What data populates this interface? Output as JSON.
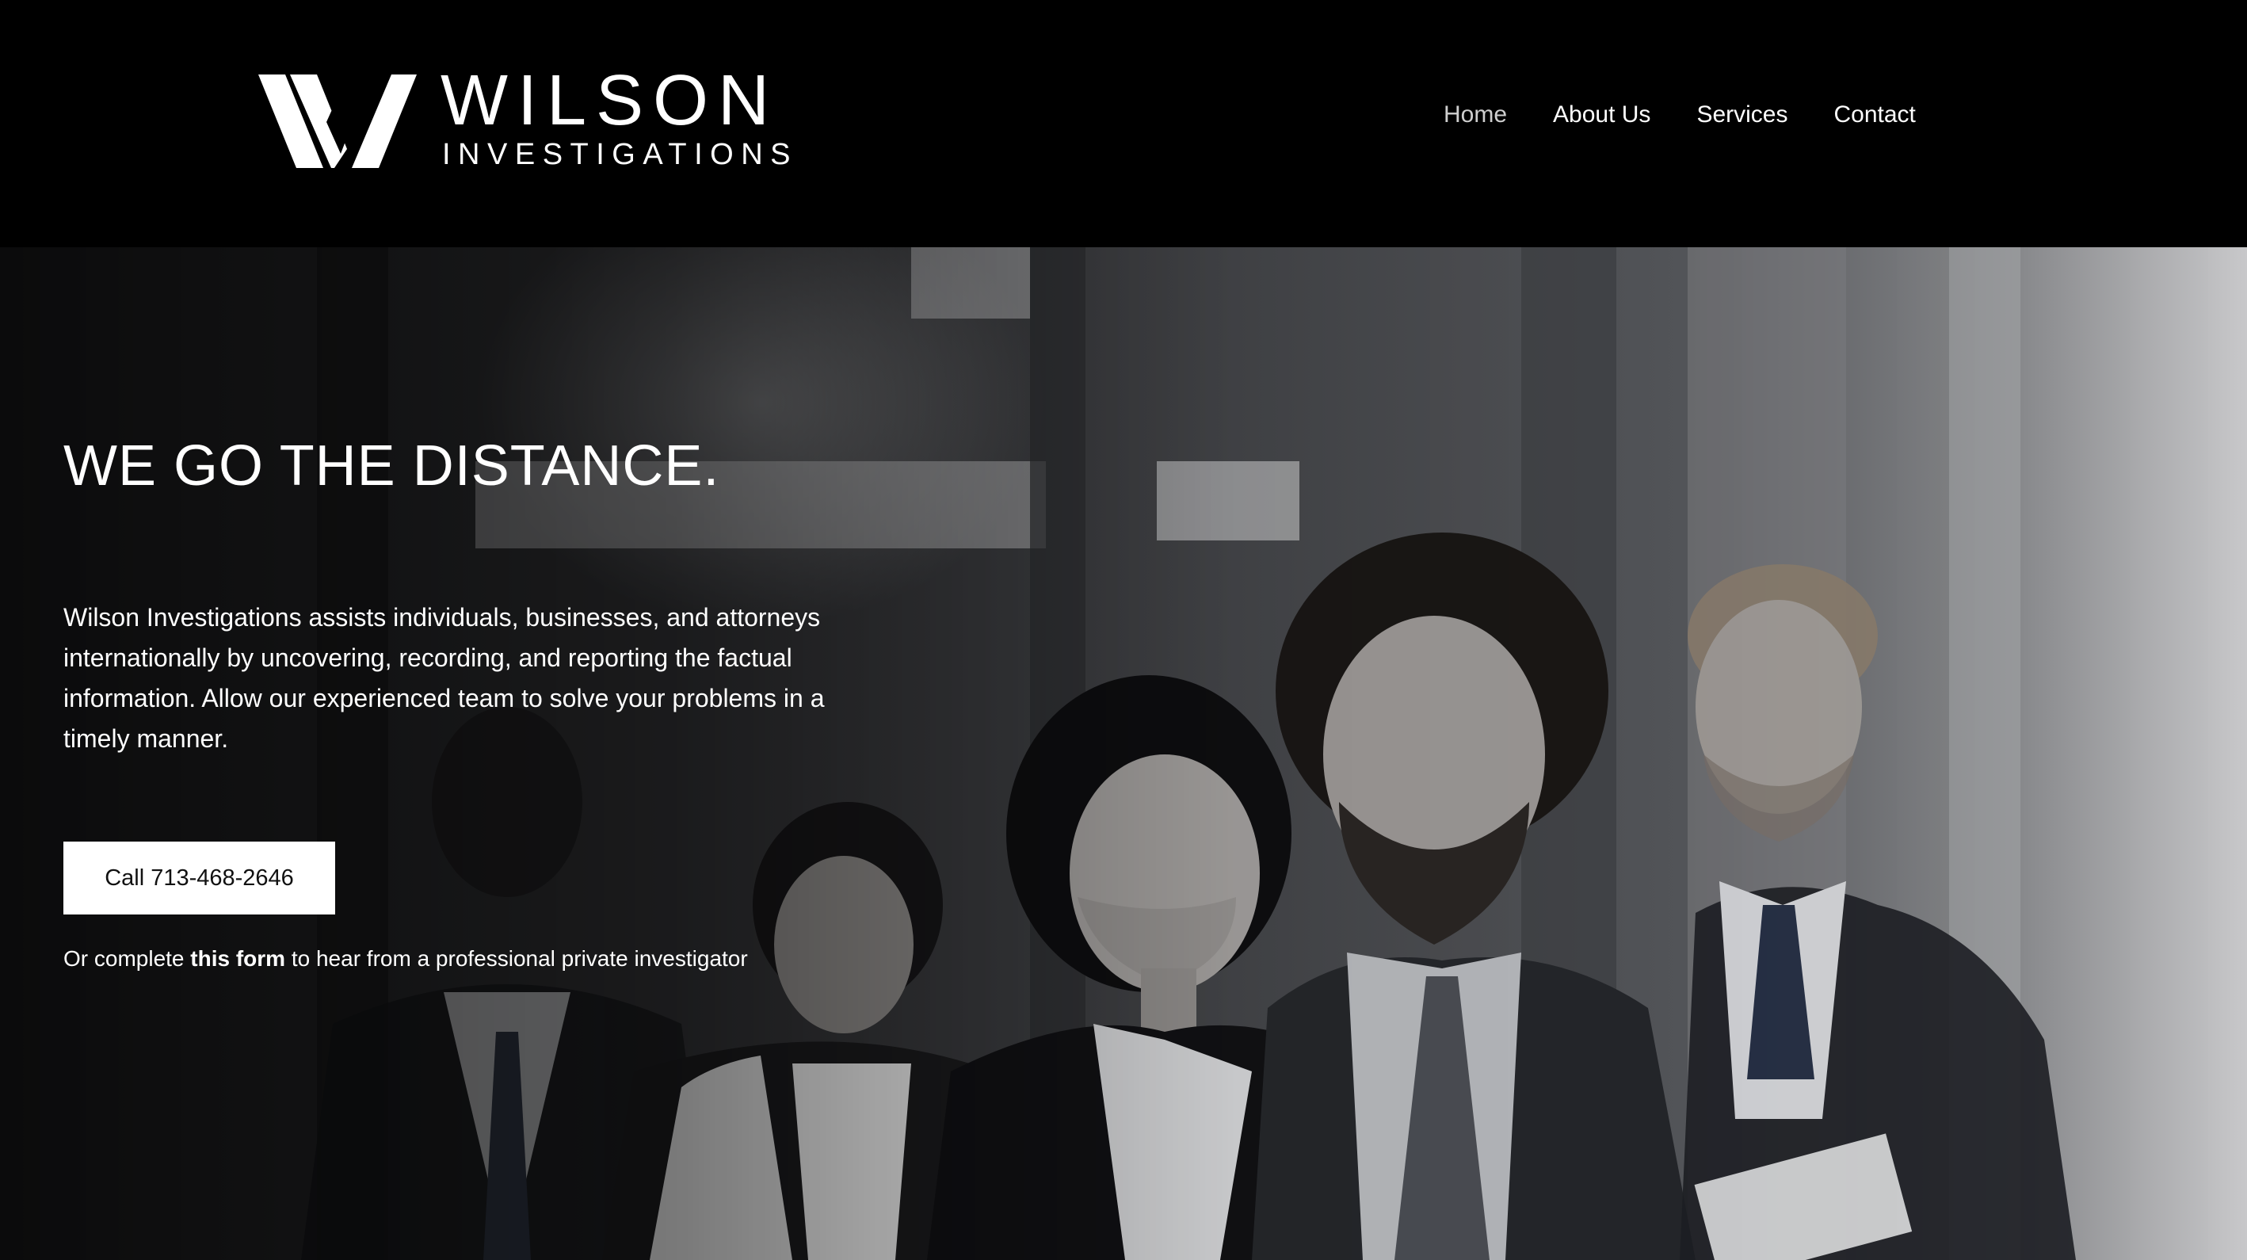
{
  "header": {
    "logo": {
      "name": "WILSON",
      "subtitle": "INVESTIGATIONS"
    },
    "nav": [
      {
        "label": "Home",
        "active": true
      },
      {
        "label": "About Us",
        "active": false
      },
      {
        "label": "Services",
        "active": false
      },
      {
        "label": "Contact",
        "active": false
      }
    ]
  },
  "hero": {
    "title": "WE GO THE DISTANCE.",
    "description": "Wilson Investigations assists individuals, businesses, and attorneys internationally by uncovering, recording, and reporting the factual information. Allow our experienced team to solve your problems in a timely manner.",
    "cta_label": "Call 713-468-2646",
    "form_note": {
      "prefix": "Or complete",
      "link": "this form",
      "suffix": "to hear from a professional private investigator"
    },
    "image": "team-of-business-professionals-photo"
  },
  "colors": {
    "header_bg": "#000000",
    "text": "#ffffff",
    "nav_active": "#cfcfcf",
    "cta_bg": "#ffffff",
    "cta_text": "#111111"
  }
}
